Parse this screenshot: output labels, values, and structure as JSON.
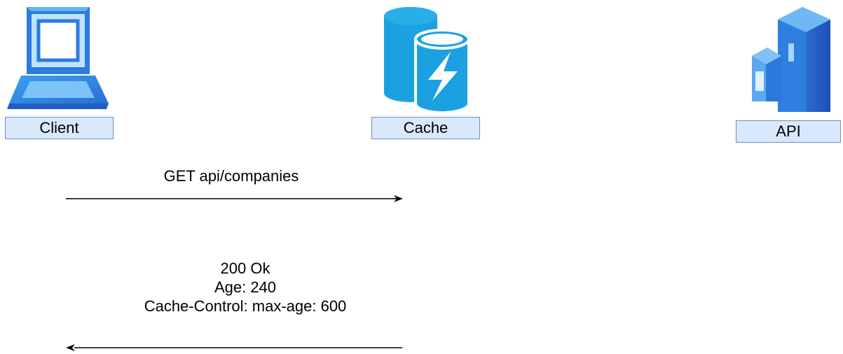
{
  "nodes": {
    "client": {
      "label": "Client",
      "icon": "laptop-icon"
    },
    "cache": {
      "label": "Cache",
      "icon": "cache-database-icon"
    },
    "api": {
      "label": "API",
      "icon": "server-icon"
    }
  },
  "messages": {
    "request": {
      "label": "GET api/companies"
    },
    "response": {
      "lines": [
        "200 Ok",
        "Age: 240",
        "Cache-Control: max-age: 600"
      ]
    }
  },
  "colors": {
    "label_fill": "#dae8fc",
    "label_border": "#6c8ebf",
    "icon_blue": "#1ba1e2",
    "icon_dark": "#2f6fd6"
  }
}
